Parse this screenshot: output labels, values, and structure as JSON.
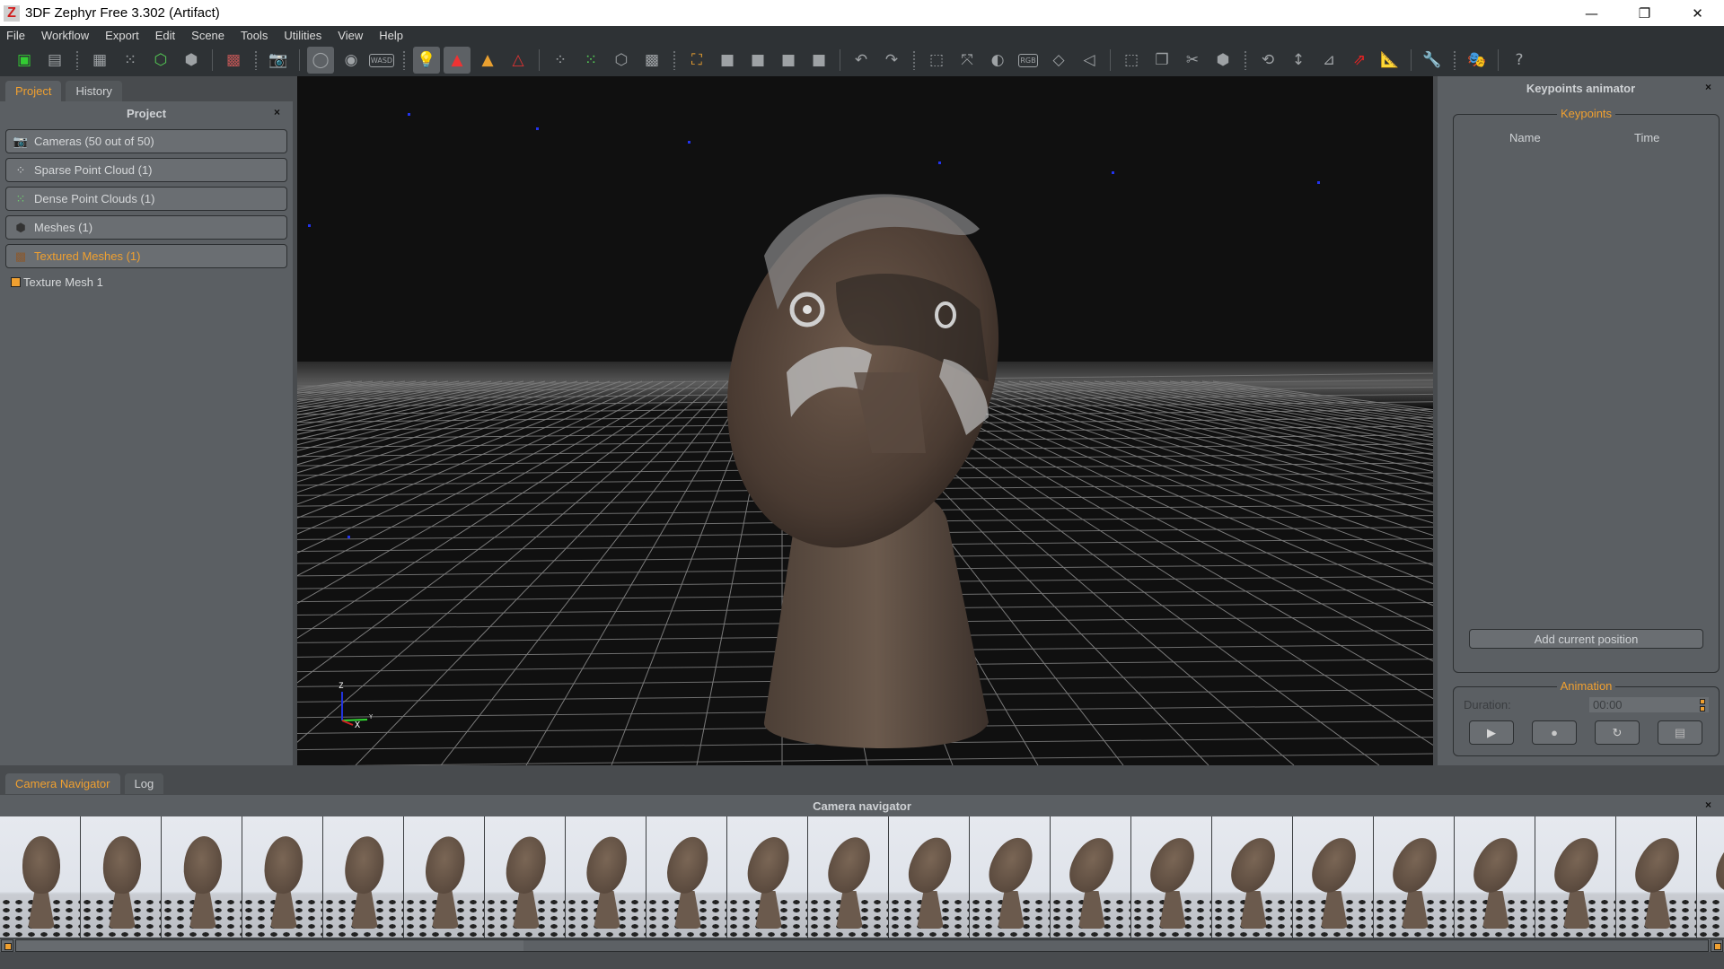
{
  "window": {
    "app_icon": "Z",
    "title": "3DF Zephyr Free 3.302 (Artifact)",
    "controls": {
      "minimize": "—",
      "restore": "❐",
      "close": "✕"
    }
  },
  "menu": [
    "File",
    "Workflow",
    "Export",
    "Edit",
    "Scene",
    "Tools",
    "Utilities",
    "View",
    "Help"
  ],
  "toolbar": {
    "groups": [
      [
        {
          "name": "open-project-icon",
          "glyph": "▣"
        },
        {
          "name": "save-project-icon",
          "glyph": "▤"
        }
      ],
      [
        {
          "name": "show-cameras-icon",
          "glyph": "▦"
        },
        {
          "name": "show-sparse-cloud-icon",
          "glyph": "⁙"
        },
        {
          "name": "show-dense-cloud-icon",
          "glyph": "⬡"
        },
        {
          "name": "show-mesh-icon",
          "glyph": "⬢"
        }
      ],
      [
        {
          "name": "show-textured-mesh-icon",
          "glyph": "▩"
        }
      ],
      [
        {
          "name": "screenshot-camera-icon",
          "glyph": "📷"
        }
      ],
      [
        {
          "name": "orbit-navigation-icon",
          "glyph": "◯",
          "active": true
        },
        {
          "name": "pivot-navigation-icon",
          "glyph": "◉"
        },
        {
          "name": "wasd-navigation-icon",
          "glyph": "WASD"
        }
      ],
      [
        {
          "name": "lighting-icon",
          "glyph": "💡",
          "active": true
        },
        {
          "name": "vertex-colors-icon",
          "glyph": "▲",
          "active": true
        },
        {
          "name": "shading-mode-icon",
          "glyph": "▲"
        },
        {
          "name": "wireframe-colors-icon",
          "glyph": "△"
        }
      ],
      [
        {
          "name": "sparse-points-icon",
          "glyph": "⁘"
        },
        {
          "name": "dense-points-icon",
          "glyph": "⁙"
        },
        {
          "name": "mesh-box-icon",
          "glyph": "⬡"
        },
        {
          "name": "textured-box-icon",
          "glyph": "▩"
        }
      ],
      [
        {
          "name": "lock-selection-icon",
          "glyph": "⛶"
        },
        {
          "name": "select-add-icon",
          "glyph": "■"
        },
        {
          "name": "select-remove-icon",
          "glyph": "■"
        },
        {
          "name": "select-search-icon",
          "glyph": "■"
        },
        {
          "name": "select-clear-icon",
          "glyph": "■"
        }
      ],
      [
        {
          "name": "undo-icon",
          "glyph": "↶"
        },
        {
          "name": "redo-icon",
          "glyph": "↷"
        }
      ],
      [
        {
          "name": "rect-select-icon",
          "glyph": "⬚"
        },
        {
          "name": "lasso-select-icon",
          "glyph": "⤧"
        },
        {
          "name": "invert-selection-icon",
          "glyph": "◐"
        },
        {
          "name": "color-select-icon",
          "glyph": "RGB"
        },
        {
          "name": "select-diamond-icon",
          "glyph": "◇"
        },
        {
          "name": "select-triangle-icon",
          "glyph": "◁"
        }
      ],
      [
        {
          "name": "delete-selection-icon",
          "glyph": "⬚"
        },
        {
          "name": "copy-selection-icon",
          "glyph": "❐"
        },
        {
          "name": "cut-selection-icon",
          "glyph": "✂"
        },
        {
          "name": "bounding-box-icon",
          "glyph": "⬢"
        }
      ],
      [
        {
          "name": "rotate-gizmo-icon",
          "glyph": "⟲"
        },
        {
          "name": "measure-distance-icon",
          "glyph": "↕"
        },
        {
          "name": "measure-angle-icon",
          "glyph": "⊿"
        },
        {
          "name": "axis-gizmo-icon",
          "glyph": "⇗"
        },
        {
          "name": "ruler-icon",
          "glyph": "📐"
        }
      ],
      [
        {
          "name": "tools-wrench-icon",
          "glyph": "🔧"
        }
      ],
      [
        {
          "name": "mask-icon",
          "glyph": "🎭"
        }
      ],
      [
        {
          "name": "help-icon",
          "glyph": "?"
        }
      ]
    ]
  },
  "left_panel": {
    "tabs": [
      {
        "label": "Project",
        "active": true
      },
      {
        "label": "History",
        "active": false
      }
    ],
    "header": "Project",
    "close_glyph": "×",
    "items": [
      {
        "label": "Cameras (50 out of 50)",
        "icon": "camera-icon",
        "glyph": "📷",
        "highlighted": false
      },
      {
        "label": "Sparse Point Cloud (1)",
        "icon": "sparse-cloud-icon",
        "glyph": "⁘",
        "highlighted": false
      },
      {
        "label": "Dense Point Clouds (1)",
        "icon": "dense-cloud-icon",
        "glyph": "⁙",
        "highlighted": false
      },
      {
        "label": "Meshes (1)",
        "icon": "mesh-icon",
        "glyph": "⬢",
        "highlighted": false
      },
      {
        "label": "Textured Meshes (1)",
        "icon": "textured-mesh-icon",
        "glyph": "▩",
        "highlighted": true
      }
    ],
    "tree_items": [
      {
        "label": "Texture Mesh 1",
        "checked": true
      }
    ]
  },
  "viewport": {
    "axes": {
      "z": "Z",
      "x": "X",
      "y": "Y"
    }
  },
  "right_panel": {
    "header": "Keypoints animator",
    "close_glyph": "×",
    "keypoints": {
      "title": "Keypoints",
      "columns": [
        "Name",
        "Time"
      ],
      "rows": [],
      "add_button": "Add current position"
    },
    "animation": {
      "title": "Animation",
      "duration_label": "Duration:",
      "duration_value": "00:00",
      "buttons": [
        {
          "name": "play-button",
          "glyph": "▶"
        },
        {
          "name": "record-button",
          "glyph": "●"
        },
        {
          "name": "loop-button",
          "glyph": "↻"
        },
        {
          "name": "export-video-button",
          "glyph": "▤"
        }
      ]
    }
  },
  "bottom_panel": {
    "tabs": [
      {
        "label": "Camera Navigator",
        "active": true
      },
      {
        "label": "Log",
        "active": false
      }
    ],
    "header": "Camera navigator",
    "close_glyph": "×",
    "thumbnail_count_visible": 22,
    "scroll_position": 0.0,
    "scroll_visible_fraction": 0.3
  },
  "colors": {
    "accent": "#f0a030",
    "panel": "#5b5f63",
    "dark": "#2e3235",
    "viewport_bg": "#101010",
    "grid": "#7a7a7a"
  }
}
